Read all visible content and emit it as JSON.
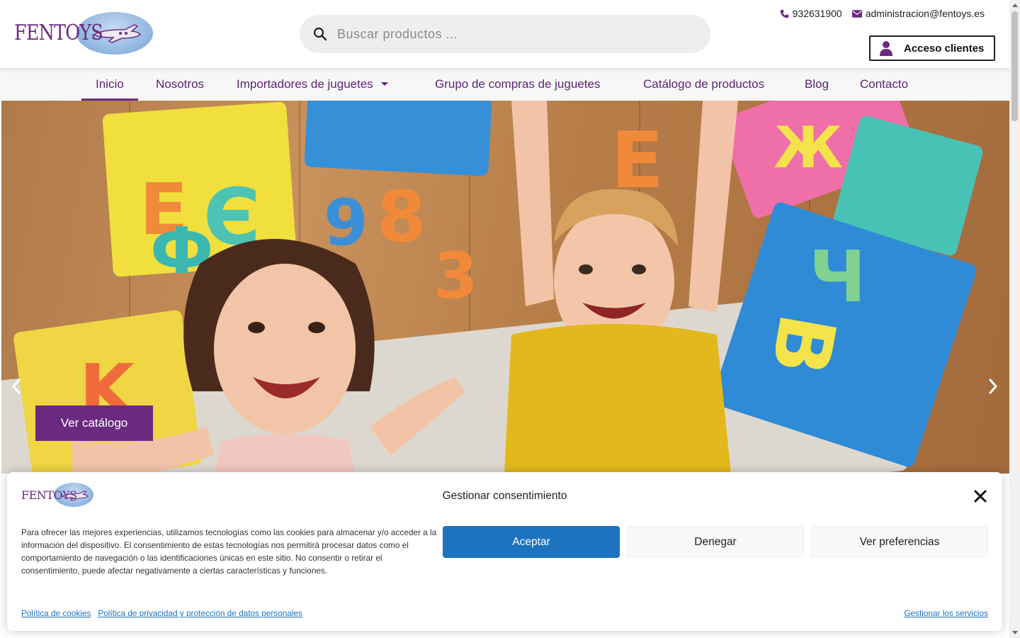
{
  "brand": {
    "logo_text": "FENTOYS",
    "logo_small": "FENTOYS"
  },
  "header": {
    "search_placeholder": "Buscar productos ...",
    "phone": "932631900",
    "email": "administracion@fentoys.es",
    "access_label": "Acceso clientes"
  },
  "nav": {
    "items": [
      {
        "label": "Inicio",
        "active": true
      },
      {
        "label": "Nosotros"
      },
      {
        "label": "Importadores de juguetes",
        "has_dropdown": true
      },
      {
        "label": "Grupo de compras de juguetes"
      },
      {
        "label": "Catálogo de productos"
      },
      {
        "label": "Blog"
      },
      {
        "label": "Contacto"
      }
    ]
  },
  "hero": {
    "cta_label": "Ver catálogo"
  },
  "cookie": {
    "title": "Gestionar consentimiento",
    "text": "Para ofrecer las mejores experiencias, utilizamos tecnologías como las cookies para almacenar y/o acceder a la información del dispositivo. El consentimiento de estas tecnologías nos permitirá procesar datos como el comportamiento de navegación o las identificaciones únicas en este sitio. No consentir o retirar el consentimiento, puede afectar negativamente a ciertas características y funciones.",
    "accept_label": "Aceptar",
    "deny_label": "Denegar",
    "prefs_label": "Ver preferencias",
    "link_cookies": "Política de cookies",
    "link_privacy": "Política de privacidad y protección de datos personales",
    "link_manage": "Gestionar los servicios"
  },
  "colors": {
    "brand_purple": "#6b2a7f",
    "accept_blue": "#1e73be",
    "nav_bg": "#f7f7f7"
  },
  "icons": [
    "search-icon",
    "phone-icon",
    "envelope-icon",
    "user-icon",
    "chevron-down-icon",
    "chevron-left-icon",
    "chevron-right-icon",
    "close-icon",
    "plane-icon"
  ]
}
